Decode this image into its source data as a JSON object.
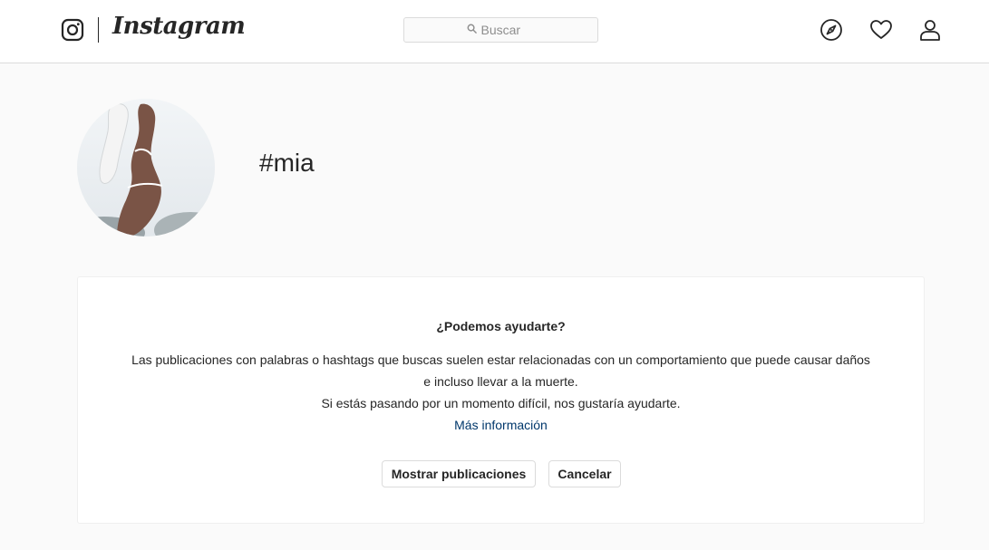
{
  "nav": {
    "brand": "Instagram",
    "search_placeholder": "Buscar",
    "icons": [
      "instagram-glyph-icon",
      "search-icon",
      "compass-icon",
      "heart-icon",
      "profile-icon"
    ]
  },
  "header": {
    "hashtag": "#mia"
  },
  "help_card": {
    "title": "¿Podemos ayudarte?",
    "line1": "Las publicaciones con palabras o hashtags que buscas suelen estar relacionadas con un comportamiento que puede causar daños",
    "line2": "e incluso llevar a la muerte.",
    "line3": "Si estás pasando por un momento difícil, nos gustaría ayudarte.",
    "more_info_link": "Más información",
    "show_posts_button": "Mostrar publicaciones",
    "cancel_button": "Cancelar"
  },
  "colors": {
    "background": "#fafafa",
    "text": "#262626",
    "link": "#00376b",
    "border": "#dbdbdb"
  }
}
